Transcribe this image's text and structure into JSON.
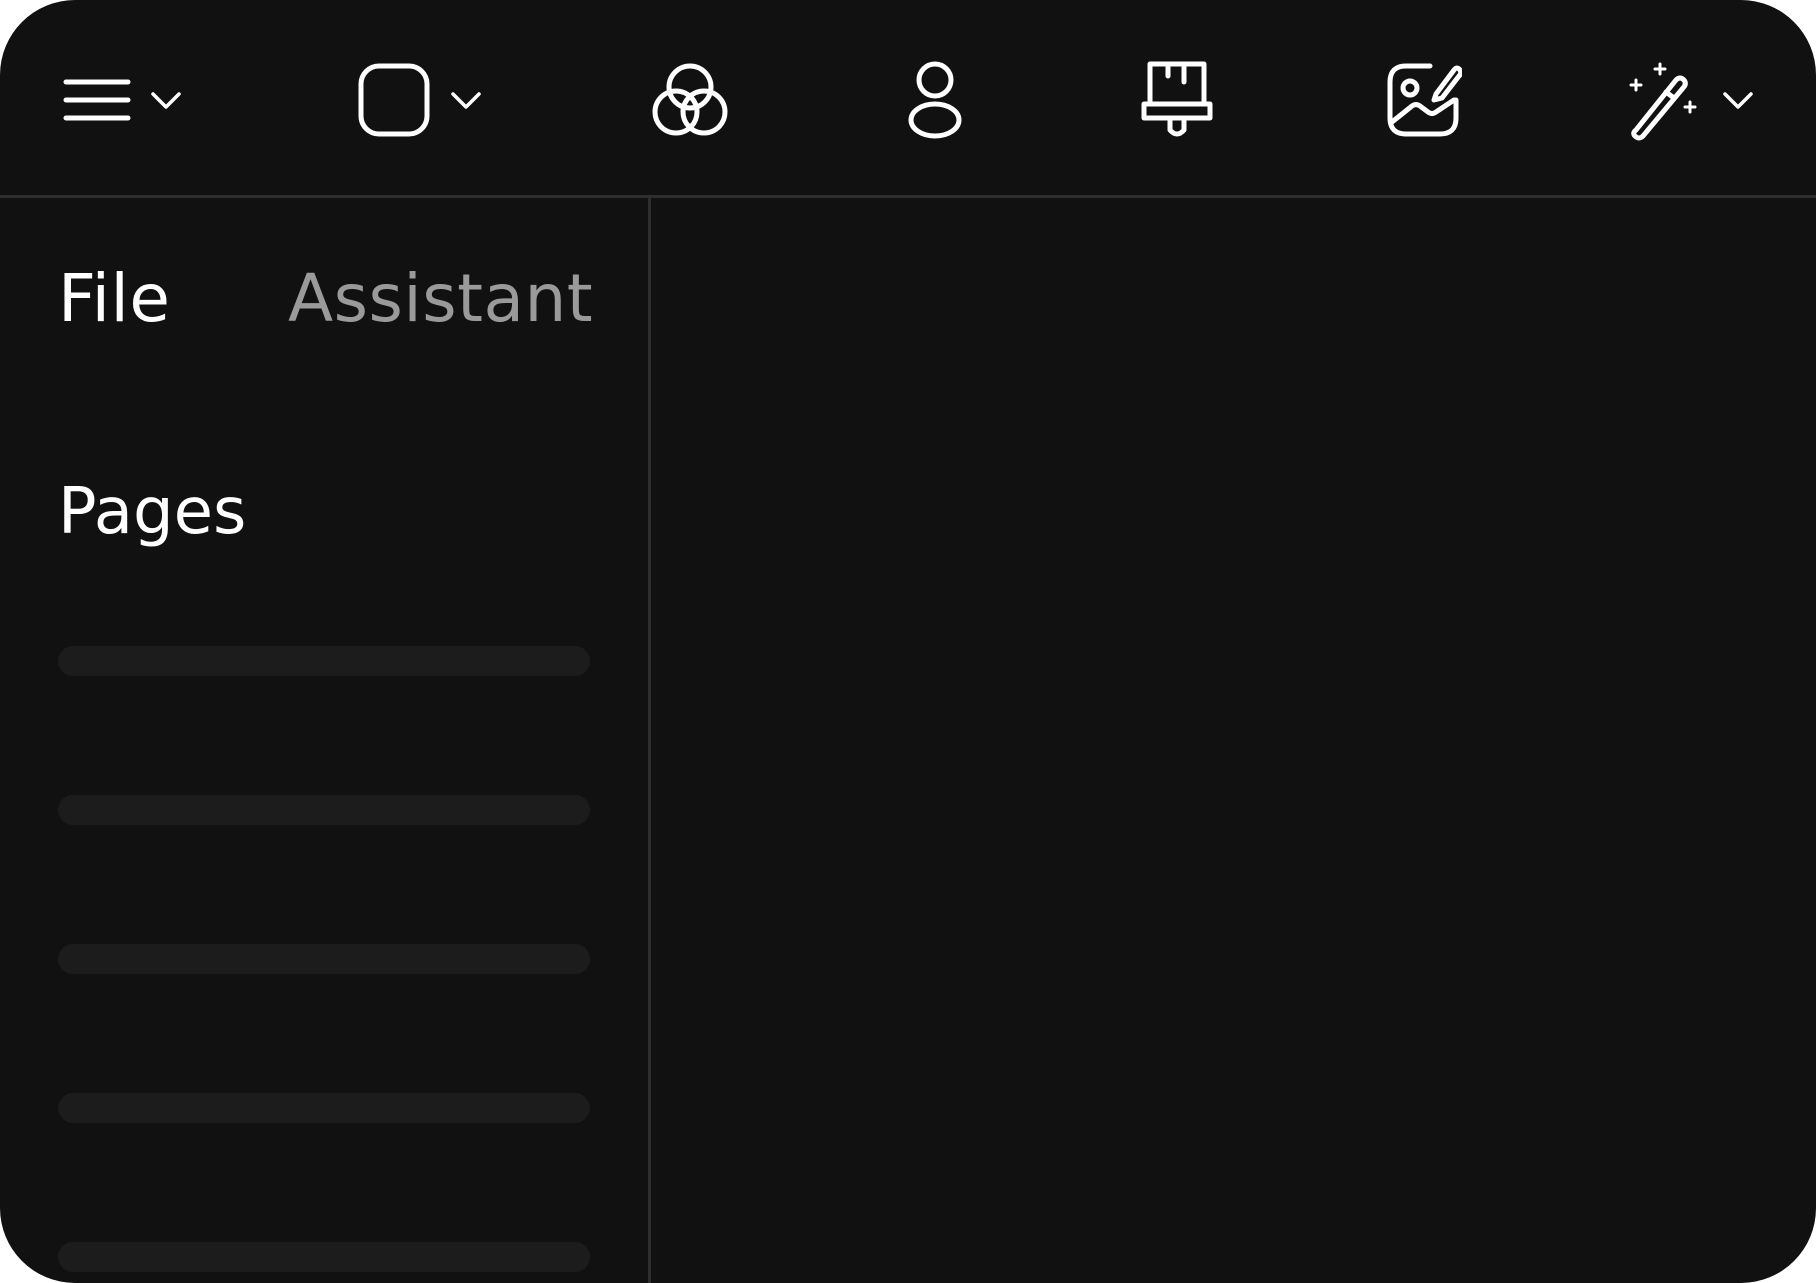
{
  "sidebar": {
    "tabs": [
      {
        "label": "File",
        "active": true
      },
      {
        "label": "Assistant",
        "active": false
      }
    ],
    "section_title": "Pages",
    "page_placeholders": 5
  },
  "toolbar": {
    "icons": [
      "menu-icon",
      "frame-shape-icon",
      "color-circles-icon",
      "user-icon",
      "paint-brush-icon",
      "edit-image-icon",
      "magic-wand-icon"
    ]
  },
  "colors": {
    "background": "#111111",
    "divider": "#2e2e2e",
    "text_active": "#ffffff",
    "text_inactive": "#9a9a9a",
    "placeholder": "#1c1c1c"
  }
}
